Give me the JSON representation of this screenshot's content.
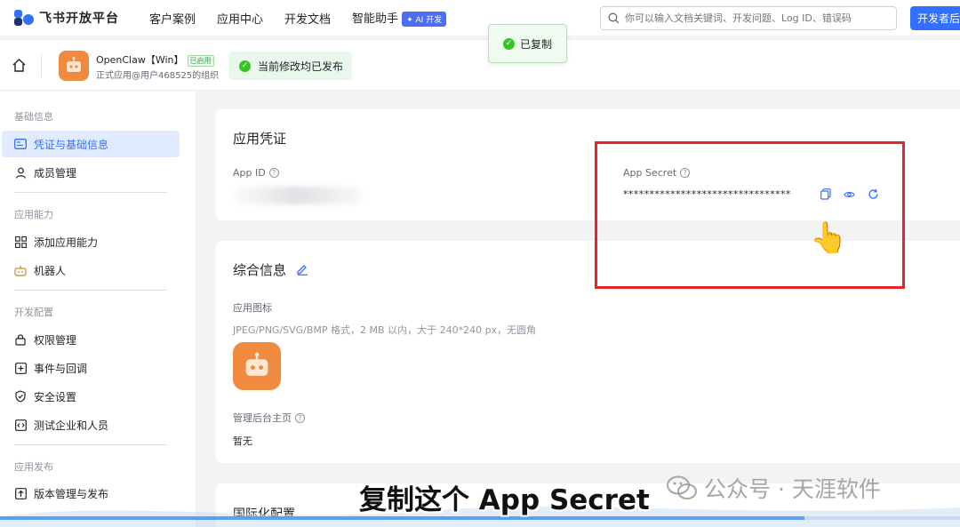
{
  "topnav": {
    "logo_text": "飞书开放平台",
    "items": [
      "客户案例",
      "应用中心",
      "开发文档",
      "智能助手"
    ],
    "ai_badge": "✦ AI 开发",
    "search_placeholder": "你可以输入文档关键词、开发问题、Log ID、错误码",
    "dev_button": "开发者后台"
  },
  "toast": {
    "text": "已复制"
  },
  "appbar": {
    "app_name": "OpenClaw【Win】",
    "app_status": "已启用",
    "app_sub": "正式应用@用户468525的组织",
    "published": "当前修改均已发布"
  },
  "sidebar": {
    "sections": [
      {
        "title": "基础信息",
        "items": [
          "凭证与基础信息",
          "成员管理"
        ]
      },
      {
        "title": "应用能力",
        "items": [
          "添加应用能力",
          "机器人"
        ]
      },
      {
        "title": "开发配置",
        "items": [
          "权限管理",
          "事件与回调",
          "安全设置",
          "测试企业和人员"
        ]
      },
      {
        "title": "应用发布",
        "items": [
          "版本管理与发布"
        ]
      }
    ],
    "active_item": "凭证与基础信息"
  },
  "credentials": {
    "title": "应用凭证",
    "app_id_label": "App ID",
    "app_secret_label": "App Secret",
    "app_secret_value": "********************************"
  },
  "general": {
    "title": "综合信息",
    "icon_label": "应用图标",
    "icon_hint": "JPEG/PNG/SVG/BMP 格式，2 MB 以内，大于 240*240 px，无圆角",
    "homepage_label": "管理后台主页",
    "homepage_value": "暂无"
  },
  "i18n": {
    "title": "国际化配置"
  },
  "overlay": {
    "subtitle": "复制这个 App Secret",
    "watermark": "公众号 · 天涯软件"
  },
  "colors": {
    "accent": "#3370ff",
    "highlight": "#e3262b",
    "app_orange": "#f08a3e",
    "success": "#34c724"
  },
  "icons": [
    "feishu-logo-icon",
    "search-icon",
    "home-icon",
    "robot-icon",
    "check-circle-icon",
    "copy-icon",
    "eye-icon",
    "refresh-icon",
    "edit-icon",
    "question-icon",
    "pointing-hand-icon",
    "wechat-icon"
  ]
}
